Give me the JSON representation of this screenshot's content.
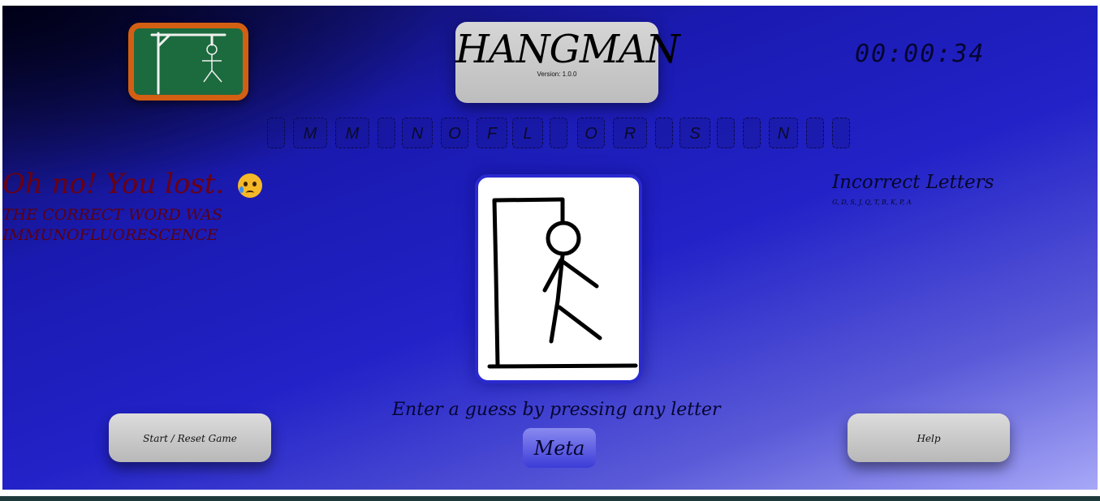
{
  "header": {
    "title": "HANGMAN",
    "version": "Version: 1.0.0",
    "timer": "00:00:34",
    "logo_icon": "hangman-chalkboard-icon"
  },
  "word_slots": [
    "",
    "M",
    "M",
    "",
    "N",
    "O",
    "F",
    "L",
    "",
    "O",
    "R",
    "",
    "S",
    "",
    "",
    "N",
    "",
    ""
  ],
  "status": {
    "message": "Oh no! You lost.",
    "emoji_icon": "sad-face-with-tear-icon",
    "correct_word_line1": "The correct word was",
    "correct_word_line2": "immunofluorescence"
  },
  "incorrect": {
    "title": "Incorrect Letters",
    "letters": "G, D, S, J, Q, T, B, K, P, A"
  },
  "prompt": "Enter a guess by pressing any letter",
  "buttons": {
    "start_reset": "Start / Reset Game",
    "meta": "Meta",
    "help": "Help"
  },
  "colors": {
    "background_start": "#0a0a3a",
    "background_end": "#a8a8f8",
    "lost_text": "#6a0010",
    "logo_border": "#d35f12",
    "logo_board": "#1c6b3e"
  }
}
